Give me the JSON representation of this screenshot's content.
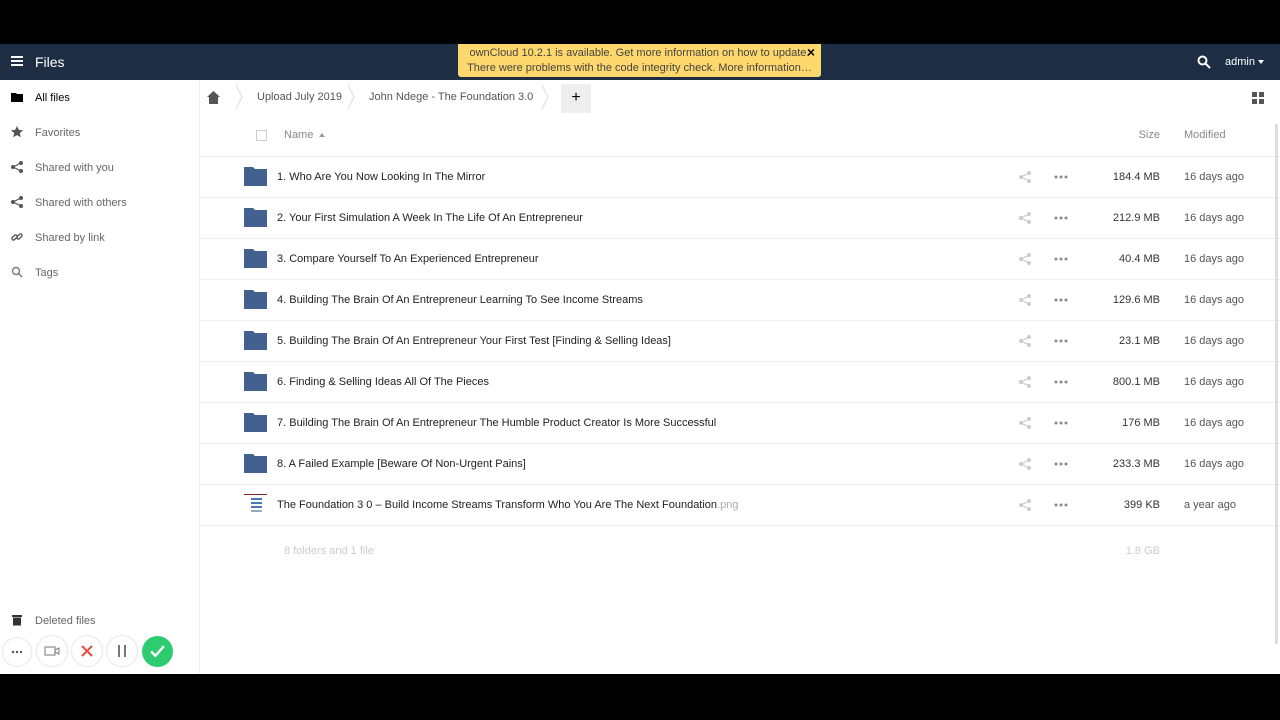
{
  "header": {
    "app_title": "Files",
    "notice_line1": "ownCloud 10.2.1 is available. Get more information on how to update.",
    "notice_line2": "There were problems with the code integrity check. More information…",
    "notice_close": "×",
    "user": "admin"
  },
  "sidebar": {
    "items": [
      {
        "label": "All files",
        "icon": "folder-icon"
      },
      {
        "label": "Favorites",
        "icon": "star-icon"
      },
      {
        "label": "Shared with you",
        "icon": "share-icon"
      },
      {
        "label": "Shared with others",
        "icon": "share-icon"
      },
      {
        "label": "Shared by link",
        "icon": "link-icon"
      },
      {
        "label": "Tags",
        "icon": "search-icon"
      }
    ],
    "deleted": "Deleted files"
  },
  "breadcrumb": [
    "Upload July 2019",
    "John Ndege - The Foundation 3.0"
  ],
  "add_label": "+",
  "table": {
    "col_name": "Name",
    "col_size": "Size",
    "col_modified": "Modified",
    "rows": [
      {
        "name": "1. Who Are You Now Looking In The Mirror",
        "ext": "",
        "size": "184.4 MB",
        "modified": "16 days ago"
      },
      {
        "name": "2. Your First Simulation A Week In The Life Of An Entrepreneur",
        "ext": "",
        "size": "212.9 MB",
        "modified": "16 days ago"
      },
      {
        "name": "3. Compare Yourself To An Experienced Entrepreneur",
        "ext": "",
        "size": "40.4 MB",
        "modified": "16 days ago"
      },
      {
        "name": "4. Building The Brain Of An Entrepreneur Learning To See Income Streams",
        "ext": "",
        "size": "129.6 MB",
        "modified": "16 days ago"
      },
      {
        "name": "5. Building The Brain Of An Entrepreneur Your First Test [Finding & Selling Ideas]",
        "ext": "",
        "size": "23.1 MB",
        "modified": "16 days ago"
      },
      {
        "name": "6. Finding & Selling Ideas All Of The Pieces",
        "ext": "",
        "size": "800.1 MB",
        "modified": "16 days ago"
      },
      {
        "name": "7. Building The Brain Of An Entrepreneur The Humble Product Creator Is More Successful",
        "ext": "",
        "size": "176 MB",
        "modified": "16 days ago"
      },
      {
        "name": "8. A Failed Example [Beware Of Non-Urgent Pains]",
        "ext": "",
        "size": "233.3 MB",
        "modified": "16 days ago"
      },
      {
        "name": "The Foundation 3 0 – Build Income Streams Transform Who You Are The Next Foundation",
        "ext": ".png",
        "size": "399 KB",
        "modified": "a year ago"
      }
    ],
    "summary_count": "8 folders and 1 file",
    "summary_size": "1.8 GB"
  },
  "colors": {
    "header": "#1d2d44",
    "folder": "#1d5c9c",
    "notice": "#fed86c",
    "confirm": "#2ecc71"
  }
}
